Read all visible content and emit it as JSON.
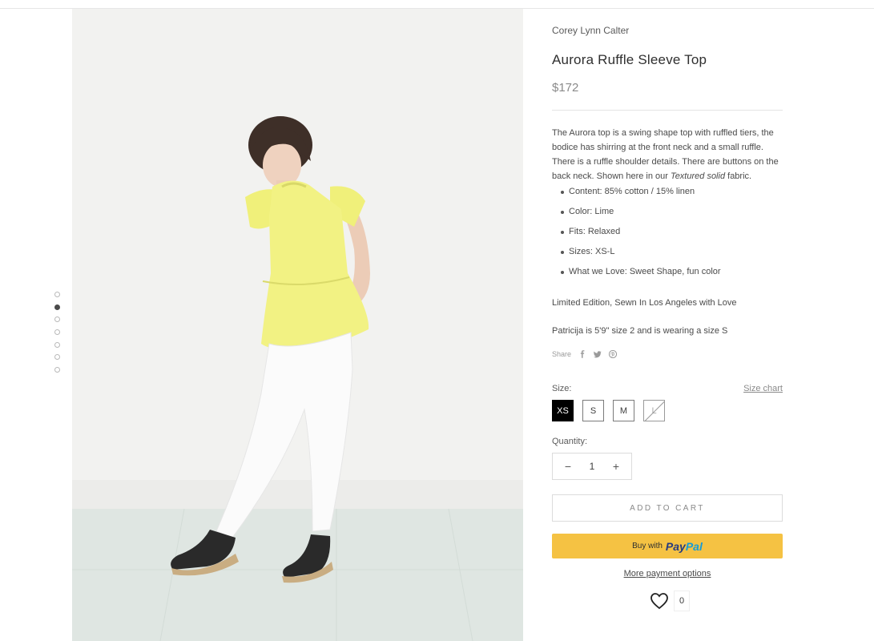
{
  "gallery": {
    "dots": [
      {
        "active": false
      },
      {
        "active": true
      },
      {
        "active": false
      },
      {
        "active": false
      },
      {
        "active": false
      },
      {
        "active": false
      },
      {
        "active": false
      }
    ]
  },
  "product": {
    "vendor": "Corey Lynn Calter",
    "title": "Aurora Ruffle Sleeve Top",
    "price": "$172",
    "description": {
      "part1": "The Aurora top is a swing shape top with ruffled tiers, the bodice has shirring at the front neck and a small ruffle. There is a ruffle shoulder details. There are buttons on the back neck. Shown here in our ",
      "emphasis": "Textured solid",
      "part2": " fabric."
    },
    "bullets": [
      "Content: 85% cotton / 15% linen",
      "Color: Lime",
      "Fits: Relaxed",
      "Sizes: XS-L",
      "What we Love: Sweet Shape, fun color"
    ],
    "limited_note": "Limited Edition, Sewn In Los Angeles with Love",
    "model_note": "Patricija is 5'9\" size 2 and is wearing a size S"
  },
  "share": {
    "label": "Share",
    "icons": [
      "facebook-icon",
      "twitter-icon",
      "pinterest-icon"
    ]
  },
  "size": {
    "label": "Size:",
    "chart_link": "Size chart",
    "options": [
      {
        "label": "XS",
        "state": "selected"
      },
      {
        "label": "S",
        "state": "available"
      },
      {
        "label": "M",
        "state": "available"
      },
      {
        "label": "L",
        "state": "soldout"
      }
    ]
  },
  "quantity": {
    "label": "Quantity:",
    "value": "1",
    "decrement": "−",
    "increment": "+"
  },
  "actions": {
    "add_to_cart": "ADD TO CART",
    "paypal_prefix": "Buy with",
    "paypal_brand_a": "Pay",
    "paypal_brand_b": "Pal",
    "more_payment": "More payment options"
  },
  "wishlist": {
    "icon": "heart-icon",
    "count": "0"
  },
  "colors": {
    "paypal_yellow": "#f5c243",
    "paypal_navy": "#253b80",
    "paypal_blue": "#179bd7",
    "top_lime": "#f0f07a"
  }
}
